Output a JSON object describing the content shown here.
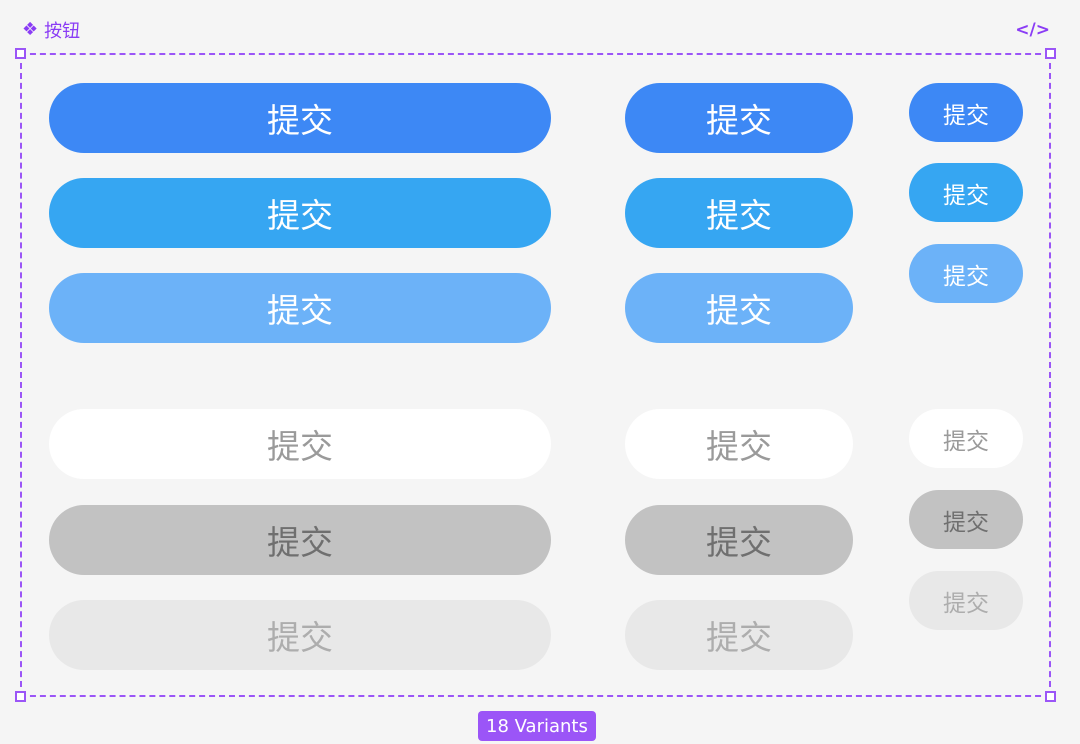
{
  "component": {
    "title": "按钮",
    "title_icon": "component-diamond-icon",
    "code_icon_label": "</>",
    "variants_label": "18 Variants"
  },
  "colors": {
    "accent": "#9b55f7",
    "primary": "#3d88f5",
    "primary_hover": "#36a6f2",
    "primary_light": "#6cb2f8",
    "default_bg": "#ffffff",
    "pressed_bg": "#c2c2c2",
    "disabled_bg": "#e8e8e8"
  },
  "buttons": {
    "label": "提交"
  }
}
